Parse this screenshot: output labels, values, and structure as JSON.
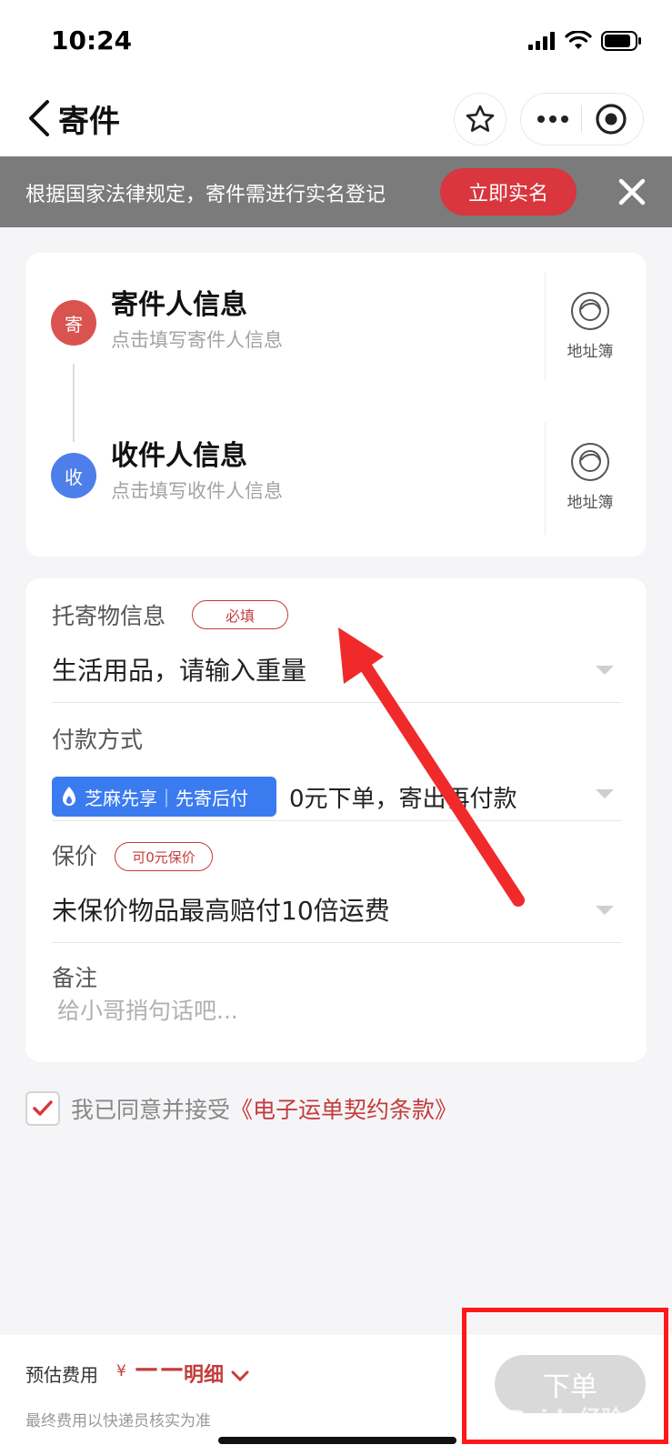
{
  "status_bar": {
    "time": "10:24"
  },
  "nav": {
    "title": "寄件"
  },
  "notice": {
    "text": "根据国家法律规定，寄件需进行实名登记",
    "button": "立即实名"
  },
  "sender": {
    "badge": "寄",
    "title": "寄件人信息",
    "subtitle": "点击填写寄件人信息",
    "book_label": "地址簿"
  },
  "receiver": {
    "badge": "收",
    "title": "收件人信息",
    "subtitle": "点击填写收件人信息",
    "book_label": "地址簿"
  },
  "cargo": {
    "label": "托寄物信息",
    "tag": "必填",
    "value": "生活用品，请输入重量"
  },
  "payment": {
    "label": "付款方式",
    "sesame_badge": "芝麻先享｜先寄后付",
    "value": "0元下单，寄出再付款"
  },
  "insurance": {
    "label": "保价",
    "tag": "可0元保价",
    "value": "未保价物品最高赔付10倍运费"
  },
  "remark": {
    "label": "备注",
    "placeholder": "给小哥捎句话吧..."
  },
  "agreement": {
    "text": "我已同意并接受",
    "link": "《电子运单契约条款》",
    "checked": true
  },
  "bottom": {
    "estimate_label": "预估费用",
    "currency": "¥",
    "estimate_value": "——",
    "detail_link": "明细",
    "note": "最终费用以快递员核实为准",
    "order_button": "下单"
  },
  "watermark": "Baidu经验",
  "colors": {
    "accent_red": "#d9363e",
    "blue": "#4e7ee9",
    "notice_bg": "#7b7b7b"
  }
}
